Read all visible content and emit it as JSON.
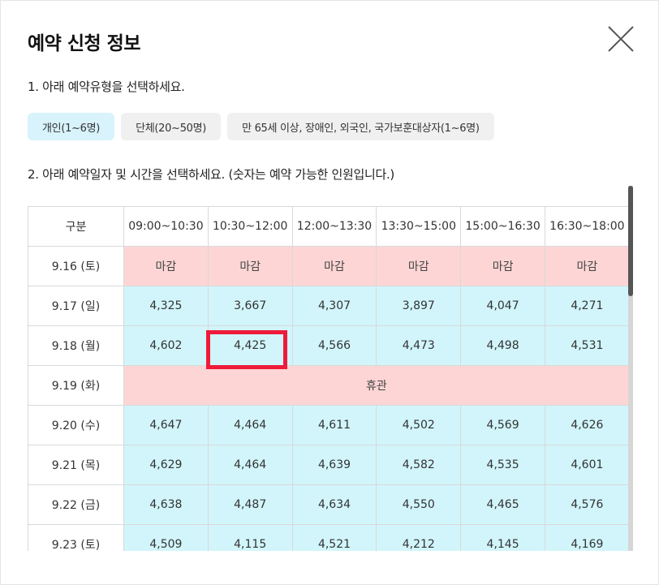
{
  "dialog": {
    "title": "예약 신청 정보"
  },
  "step1": {
    "label": "1. 아래 예약유형을 선택하세요.",
    "types": [
      {
        "label": "개인(1~6명)",
        "active": true
      },
      {
        "label": "단체(20~50명)",
        "active": false
      },
      {
        "label": "만 65세 이상, 장애인, 외국인, 국가보훈대상자(1~6명)",
        "active": false
      }
    ]
  },
  "step2": {
    "label": "2. 아래 예약일자 및 시간을 선택하세요. (숫자는 예약 가능한 인원입니다.)"
  },
  "schedule": {
    "header": [
      "구분",
      "09:00~10:30",
      "10:30~12:00",
      "12:00~13:30",
      "13:30~15:00",
      "15:00~16:30",
      "16:30~18:00"
    ],
    "rows": [
      {
        "date": "9.16 (토)",
        "status": "closed",
        "cells": [
          "마감",
          "마감",
          "마감",
          "마감",
          "마감",
          "마감"
        ]
      },
      {
        "date": "9.17 (일)",
        "status": "open",
        "cells": [
          "4,325",
          "3,667",
          "4,307",
          "3,897",
          "4,047",
          "4,271"
        ]
      },
      {
        "date": "9.18 (월)",
        "status": "open",
        "cells": [
          "4,602",
          "4,425",
          "4,566",
          "4,473",
          "4,498",
          "4,531"
        ]
      },
      {
        "date": "9.19 (화)",
        "status": "holiday",
        "note": "휴관"
      },
      {
        "date": "9.20 (수)",
        "status": "open",
        "cells": [
          "4,647",
          "4,464",
          "4,611",
          "4,502",
          "4,569",
          "4,626"
        ]
      },
      {
        "date": "9.21 (목)",
        "status": "open",
        "cells": [
          "4,629",
          "4,464",
          "4,639",
          "4,582",
          "4,535",
          "4,601"
        ]
      },
      {
        "date": "9.22 (금)",
        "status": "open",
        "cells": [
          "4,638",
          "4,487",
          "4,634",
          "4,550",
          "4,465",
          "4,576"
        ]
      },
      {
        "date": "9.23 (토)",
        "status": "open",
        "cells": [
          "4,509",
          "4,115",
          "4,521",
          "4,212",
          "4,145",
          "4,169"
        ]
      }
    ],
    "highlighted_cell": {
      "date": "9.18 (월)",
      "slot": "10:30~12:00"
    }
  },
  "colors": {
    "available": "#d1f5fb",
    "closed": "#fdd5d5",
    "active_type": "#d8f3fb",
    "highlight": "#ee1b3a"
  }
}
